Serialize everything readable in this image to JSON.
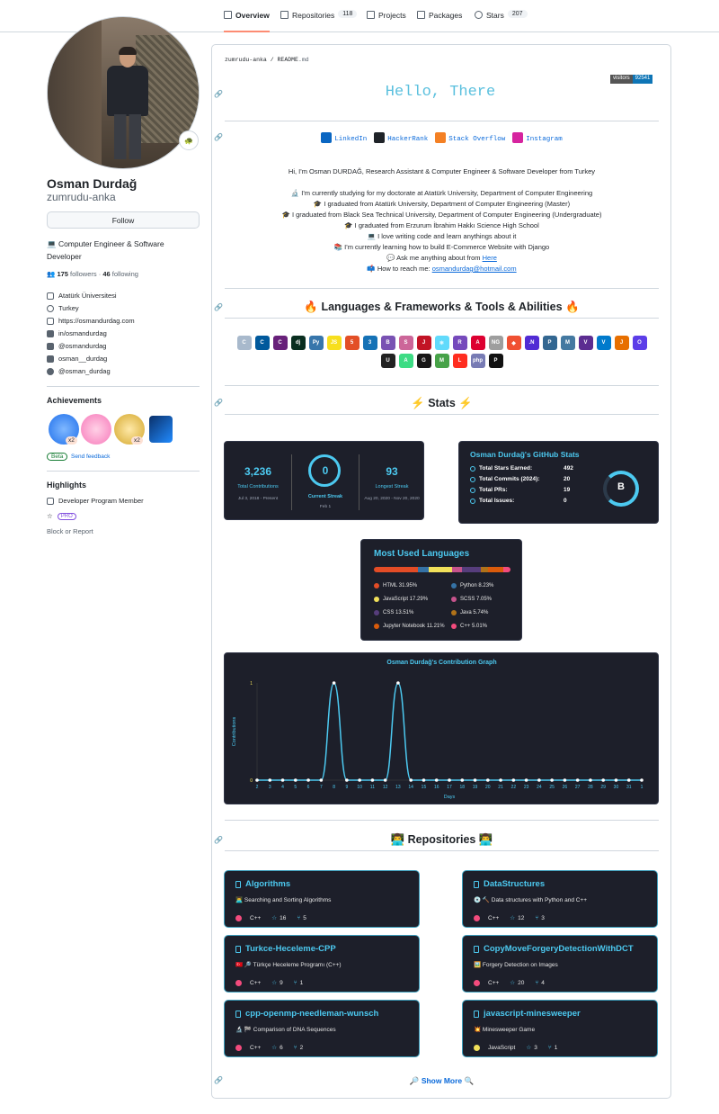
{
  "nav": {
    "tabs": [
      {
        "label": "Overview",
        "count": ""
      },
      {
        "label": "Repositories",
        "count": "118"
      },
      {
        "label": "Projects",
        "count": ""
      },
      {
        "label": "Packages",
        "count": ""
      },
      {
        "label": "Stars",
        "count": "207"
      }
    ]
  },
  "profile": {
    "name": "Osman Durdağ",
    "login": "zumrudu-anka",
    "status_emoji": "🐢",
    "follow_label": "Follow",
    "bio": "💻 Computer Engineer & Software Developer",
    "followers": "175",
    "followers_label": "followers",
    "following": "46",
    "following_label": "following",
    "details": [
      "Atatürk Üniversitesi",
      "Turkey",
      "https://osmandurdag.com",
      "in/osmandurdag",
      "@osmandurdag",
      "osman__durdag",
      "@osman_durdag"
    ],
    "achievements_title": "Achievements",
    "achievement_counts": [
      "x2",
      "x2"
    ],
    "beta_label": "Beta",
    "feedback_label": "Send feedback",
    "highlights_title": "Highlights",
    "highlight_member": "Developer Program Member",
    "highlight_pro": "PRO",
    "block_label": "Block or Report"
  },
  "readme": {
    "path_user": "zumrudu-anka",
    "path_sep": "/",
    "path_file": "README",
    "path_ext": ".md",
    "visitors_label": "visitors",
    "visitors_count": "92541",
    "hello": "Hello, There",
    "socials": [
      {
        "label": "LinkedIn",
        "color": "#0a66c2"
      },
      {
        "label": "HackerRank",
        "color": "#1f2328"
      },
      {
        "label": "Stack Overflow",
        "color": "#f48024"
      },
      {
        "label": "Instagram",
        "color": "#d6249f"
      }
    ],
    "intro_line": "Hi, I'm Osman DURDAĞ, Research Assistant & Computer Engineer & Software Developer from Turkey",
    "intro_items": [
      "🔬 I'm currently studying for my doctorate at Atatürk University, Department of Computer Engineering",
      "🎓 I graduated from Atatürk University, Department of Computer Engineering (Master)",
      "🎓 I graduated from Black Sea Technical University, Department of Computer Engineering (Undergraduate)",
      "🎓 I graduated from Erzurum İbrahim Hakkı Science High School",
      "💻 I love writing code and learn anythings about it",
      "📚 I'm currently learning how to build E-Commerce Website with Django"
    ],
    "ask_prefix": "💬 Ask me anything about from",
    "ask_link": "Here",
    "reach_prefix": "📫 How to reach me:",
    "reach_email": "osmandurdag@hotmail.com",
    "lang_heading": "🔥 Languages & Frameworks & Tools & Abilities 🔥",
    "tech_icons": [
      {
        "name": "c-icon",
        "txt": "C",
        "bg": "#a8b9cc"
      },
      {
        "name": "cplusplus-icon",
        "txt": "C",
        "bg": "#00599c"
      },
      {
        "name": "csharp-icon",
        "txt": "C",
        "bg": "#68217a"
      },
      {
        "name": "django-icon",
        "txt": "dj",
        "bg": "#092e20"
      },
      {
        "name": "python-icon",
        "txt": "Py",
        "bg": "#3776ab"
      },
      {
        "name": "javascript-icon",
        "txt": "JS",
        "bg": "#f7df1e"
      },
      {
        "name": "html5-icon",
        "txt": "5",
        "bg": "#e34f26"
      },
      {
        "name": "css3-icon",
        "txt": "3",
        "bg": "#1572b6"
      },
      {
        "name": "bootstrap-icon",
        "txt": "B",
        "bg": "#7952b3"
      },
      {
        "name": "sass-icon",
        "txt": "S",
        "bg": "#cc6699"
      },
      {
        "name": "jest-icon",
        "txt": "J",
        "bg": "#c21325"
      },
      {
        "name": "react-icon",
        "txt": "⚛",
        "bg": "#61dafb"
      },
      {
        "name": "redux-icon",
        "txt": "R",
        "bg": "#764abc"
      },
      {
        "name": "angular-icon",
        "txt": "A",
        "bg": "#dd0031"
      },
      {
        "name": "angularjs-icon",
        "txt": "NG",
        "bg": "#9e9e9e"
      },
      {
        "name": "git-icon",
        "txt": "◆",
        "bg": "#f05032"
      },
      {
        "name": "dotnet-icon",
        "txt": ".N",
        "bg": "#512bd4"
      },
      {
        "name": "postgresql-icon",
        "txt": "P",
        "bg": "#336791"
      },
      {
        "name": "mysql-icon",
        "txt": "M",
        "bg": "#4479a1"
      },
      {
        "name": "visualstudio-icon",
        "txt": "V",
        "bg": "#5c2d91"
      },
      {
        "name": "vscode-icon",
        "txt": "V",
        "bg": "#007acc"
      },
      {
        "name": "java-icon",
        "txt": "J",
        "bg": "#e76f00"
      },
      {
        "name": "opencv-icon",
        "txt": "O",
        "bg": "#5c3ee8"
      },
      {
        "name": "unity-icon",
        "txt": "U",
        "bg": "#222222"
      },
      {
        "name": "android-icon",
        "txt": "A",
        "bg": "#3ddc84"
      },
      {
        "name": "github-icon",
        "txt": "G",
        "bg": "#181717"
      },
      {
        "name": "mongodb-icon",
        "txt": "M",
        "bg": "#47a248"
      },
      {
        "name": "laravel-icon",
        "txt": "L",
        "bg": "#ff2d20"
      },
      {
        "name": "php-icon",
        "txt": "php",
        "bg": "#777bb4"
      },
      {
        "name": "pascal-icon",
        "txt": "P",
        "bg": "#111111"
      }
    ],
    "stats_heading": "⚡ Stats ⚡",
    "streak": {
      "total": "3,236",
      "total_label": "Total Contributions",
      "total_range": "Jul 3, 2018 - Present",
      "current": "0",
      "current_label": "Current Streak",
      "current_range": "Feb 1",
      "longest": "93",
      "longest_label": "Longest Streak",
      "longest_range": "Aug 20, 2020 - Nov 20, 2020"
    },
    "gh_stats": {
      "title": "Osman Durdağ's GitHub Stats",
      "rows": [
        {
          "label": "Total Stars Earned:",
          "value": "492"
        },
        {
          "label": "Total Commits (2024):",
          "value": "20"
        },
        {
          "label": "Total PRs:",
          "value": "19"
        },
        {
          "label": "Total Issues:",
          "value": "0"
        }
      ],
      "grade": "B"
    },
    "languages": {
      "title": "Most Used Languages",
      "items": [
        {
          "label": "HTML 31.95%",
          "pct": 31.95,
          "color": "#e34c26"
        },
        {
          "label": "Python 8.23%",
          "pct": 8.23,
          "color": "#3572a5"
        },
        {
          "label": "JavaScript 17.29%",
          "pct": 17.29,
          "color": "#f1e05a"
        },
        {
          "label": "SCSS 7.05%",
          "pct": 7.05,
          "color": "#c6538c"
        },
        {
          "label": "CSS 13.51%",
          "pct": 13.51,
          "color": "#563d7c"
        },
        {
          "label": "Java 5.74%",
          "pct": 5.74,
          "color": "#b07219"
        },
        {
          "label": "Jupyter Notebook 11.21%",
          "pct": 11.21,
          "color": "#da5b0b"
        },
        {
          "label": "C++ 5.01%",
          "pct": 5.01,
          "color": "#f34b7d"
        }
      ]
    },
    "repos_heading": "👨‍💻 Repositories 👨‍💻",
    "repos": [
      {
        "name": "Algorithms",
        "desc": "👨‍💻 Searching and Sorting Algorithms",
        "lang": "C++",
        "lang_color": "#f34b7d",
        "stars": "16",
        "forks": "5"
      },
      {
        "name": "DataStructures",
        "desc": "💿 🔨 Data structures with Python and C++",
        "lang": "C++",
        "lang_color": "#f34b7d",
        "stars": "12",
        "forks": "3"
      },
      {
        "name": "Turkce-Heceleme-CPP",
        "desc": "🇹🇷 🔎 Türkçe Heceleme Programı (C++)",
        "lang": "C++",
        "lang_color": "#f34b7d",
        "stars": "9",
        "forks": "1"
      },
      {
        "name": "CopyMoveForgeryDetectionWithDCT",
        "desc": "🖼️ Forgery Detection on Images",
        "lang": "C++",
        "lang_color": "#f34b7d",
        "stars": "20",
        "forks": "4"
      },
      {
        "name": "cpp-openmp-needleman-wunsch",
        "desc": "🔬 🏁 Comparison of DNA Sequences",
        "lang": "C++",
        "lang_color": "#f34b7d",
        "stars": "6",
        "forks": "2"
      },
      {
        "name": "javascript-minesweeper",
        "desc": "💥 Minesweeper Game",
        "lang": "JavaScript",
        "lang_color": "#f1e05a",
        "stars": "3",
        "forks": "1"
      }
    ],
    "show_more": "🔎 Show More 🔍"
  },
  "chart_data": {
    "type": "line",
    "title": "Osman Durdağ's Contribution Graph",
    "xlabel": "Days",
    "ylabel": "Contributions",
    "x": [
      "2",
      "3",
      "4",
      "5",
      "6",
      "7",
      "8",
      "9",
      "10",
      "11",
      "12",
      "13",
      "14",
      "15",
      "16",
      "17",
      "18",
      "19",
      "20",
      "21",
      "22",
      "23",
      "24",
      "25",
      "26",
      "27",
      "28",
      "29",
      "30",
      "31",
      "1"
    ],
    "values": [
      0,
      0,
      0,
      0,
      0,
      0,
      1,
      0,
      0,
      0,
      0,
      1,
      0,
      0,
      0,
      0,
      0,
      0,
      0,
      0,
      0,
      0,
      0,
      0,
      0,
      0,
      0,
      0,
      0,
      0,
      0
    ],
    "ylim": [
      0,
      1
    ],
    "line_color": "#4cc9f0"
  }
}
